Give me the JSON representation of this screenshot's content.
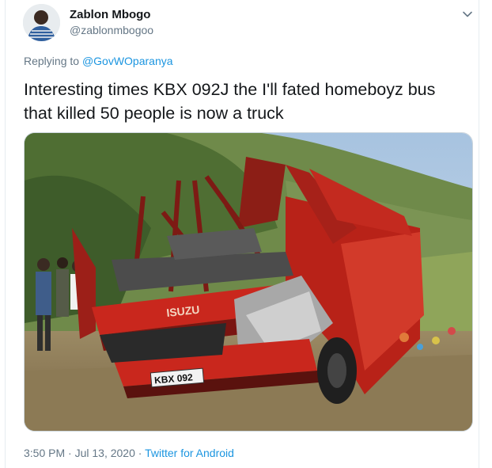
{
  "author": {
    "display_name": "Zablon Mbogo",
    "username": "@zablonmbogoo"
  },
  "reply": {
    "prefix": "Replying to",
    "mention": "@GovWOparanya"
  },
  "tweet": {
    "text_line1": "Interesting times KBX 092J the I'll fated homeboyz bus",
    "text_line2": "that killed 50 people is now a truck"
  },
  "photo": {
    "bus_brand": "ISUZU",
    "plate": "KBX 092"
  },
  "meta": {
    "time": "3:50 PM",
    "separator": "·",
    "date": "Jul 13, 2020",
    "source": "Twitter for Android"
  },
  "colors": {
    "link": "#1b95e0",
    "secondary_text": "#657786",
    "bus_red": "#c9271d"
  },
  "icons": {
    "menu": "chevron-down-icon"
  }
}
